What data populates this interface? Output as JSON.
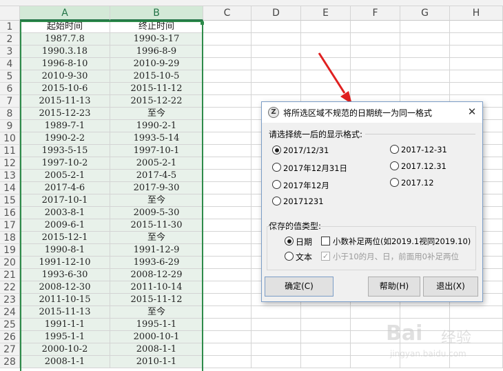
{
  "columns": [
    "A",
    "B",
    "C",
    "D",
    "E",
    "F",
    "G",
    "H"
  ],
  "rows": [
    [
      "起始时间",
      "终止时间"
    ],
    [
      "1987.7.8",
      "1990-3-17"
    ],
    [
      "1990.3.18",
      "1996-8-9"
    ],
    [
      "1996-8-10",
      "2010-9-29"
    ],
    [
      "2010-9-30",
      "2015-10-5"
    ],
    [
      "2015-10-6",
      "2015-11-12"
    ],
    [
      "2015-11-13",
      "2015-12-22"
    ],
    [
      "2015-12-23",
      "至今"
    ],
    [
      "1989-7-1",
      "1990-2-1"
    ],
    [
      "1990-2-2",
      "1993-5-14"
    ],
    [
      "1993-5-15",
      "1997-10-1"
    ],
    [
      "1997-10-2",
      "2005-2-1"
    ],
    [
      "2005-2-1",
      "2017-4-5"
    ],
    [
      "2017-4-6",
      "2017-9-30"
    ],
    [
      "2017-10-1",
      "至今"
    ],
    [
      "2003-8-1",
      "2009-5-30"
    ],
    [
      "2009-6-1",
      "2015-11-30"
    ],
    [
      "2015-12-1",
      "至今"
    ],
    [
      "1990-8-1",
      "1991-12-9"
    ],
    [
      "1991-12-10",
      "1993-6-29"
    ],
    [
      "1993-6-30",
      "2008-12-29"
    ],
    [
      "2008-12-30",
      "2011-10-14"
    ],
    [
      "2011-10-15",
      "2015-11-12"
    ],
    [
      "2015-11-13",
      "至今"
    ],
    [
      "1991-1-1",
      "1995-1-1"
    ],
    [
      "1995-1-1",
      "2000-10-1"
    ],
    [
      "2000-10-2",
      "2008-1-1"
    ],
    [
      "2008-1-1",
      "2010-1-1"
    ]
  ],
  "dialog": {
    "title": "将所选区域不规范的日期统一为同一格式",
    "app_icon_letter": "Z",
    "close_glyph": "✕",
    "format_group_label": "请选择统一后的显示格式:",
    "formats_left": [
      "2017/12/31",
      "2017年12月31日",
      "2017年12月",
      "20171231"
    ],
    "formats_right": [
      "2017-12-31",
      "2017.12.31",
      "2017.12"
    ],
    "selected_format": "2017/12/31",
    "type_group_label": "保存的值类型:",
    "type_date": "日期",
    "type_text": "文本",
    "selected_type": "日期",
    "check_decimal": "小数补足两位(如2019.1视同2019.10)",
    "check_decimal_checked": false,
    "check_padding": "小于10的月、日，前面用0补足两位",
    "check_padding_checked": true,
    "check_padding_disabled": true,
    "check_mark": "✓",
    "btn_ok": "确定(C)",
    "btn_help": "帮助(H)",
    "btn_exit": "退出(X)"
  },
  "watermark": {
    "brand": "Bai",
    "brand_suffix": "经验",
    "url": "jingyan.baidu.com"
  },
  "colors": {
    "accent_green": "#217346",
    "selection_border": "#2e8b4a",
    "selected_fill": "#e8f1ea",
    "arrow_red": "#e02020"
  }
}
